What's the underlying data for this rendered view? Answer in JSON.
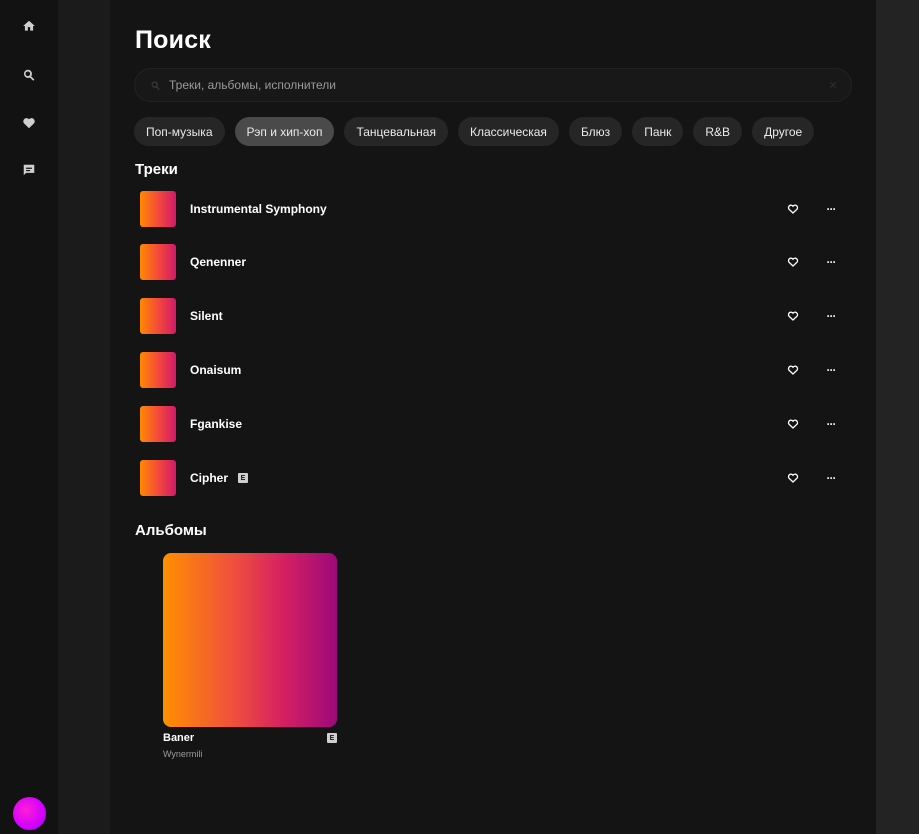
{
  "nav": {
    "items": [
      {
        "icon": "home-icon"
      },
      {
        "icon": "search-icon"
      },
      {
        "icon": "heart-icon"
      },
      {
        "icon": "chat-icon"
      }
    ]
  },
  "page": {
    "title": "Поиск"
  },
  "search": {
    "placeholder": "Треки, альбомы, исполнители",
    "value": ""
  },
  "genres": [
    {
      "label": "Поп-музыка",
      "active": false
    },
    {
      "label": "Рэп и хип-хоп",
      "active": true
    },
    {
      "label": "Танцевальная",
      "active": false
    },
    {
      "label": "Классическая",
      "active": false
    },
    {
      "label": "Блюз",
      "active": false
    },
    {
      "label": "Панк",
      "active": false
    },
    {
      "label": "R&B",
      "active": false
    },
    {
      "label": "Другое",
      "active": false
    }
  ],
  "tracks_section": {
    "title": "Треки"
  },
  "tracks": [
    {
      "title": "Instrumental Symphony",
      "explicit": false
    },
    {
      "title": "Qenenner",
      "explicit": false
    },
    {
      "title": "Silent",
      "explicit": false
    },
    {
      "title": "Onaisum",
      "explicit": false
    },
    {
      "title": "Fgankise",
      "explicit": false
    },
    {
      "title": "Cipher",
      "explicit": true
    }
  ],
  "track_actions": {
    "more_label": "···"
  },
  "explicit_label": "E",
  "albums_section": {
    "title": "Альбомы"
  },
  "albums": [
    {
      "title": "Baner",
      "artist": "Wynermili",
      "explicit": true
    }
  ],
  "colors": {
    "accent_avatar": "#d100ff",
    "cover_start": "#ff8a00",
    "cover_end": "#9c0a7a"
  }
}
